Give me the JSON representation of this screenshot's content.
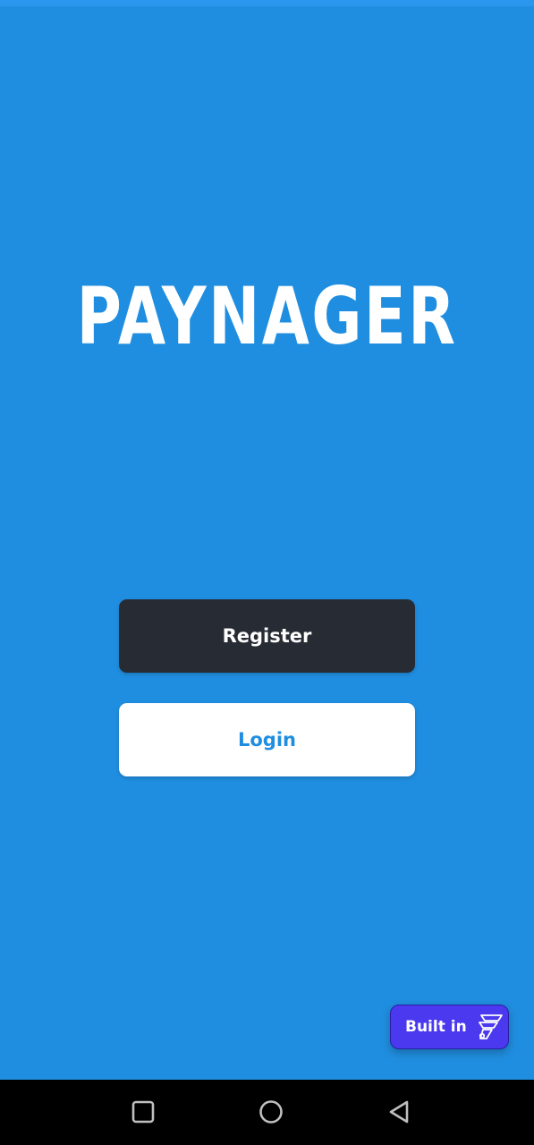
{
  "app": {
    "logo_text": "PAYNAGER"
  },
  "buttons": {
    "register_label": "Register",
    "login_label": "Login"
  },
  "badge": {
    "label": "Built in",
    "icon": "flutterflow-logo-icon"
  },
  "nav_bar": {
    "icons": [
      "square-recents-icon",
      "circle-home-icon",
      "triangle-back-icon"
    ]
  },
  "colors": {
    "background": "#208ee0",
    "register_button": "#272c34",
    "login_button": "#ffffff",
    "login_text": "#208ee0",
    "badge": "#4b39ef",
    "nav_bar": "#000000"
  }
}
